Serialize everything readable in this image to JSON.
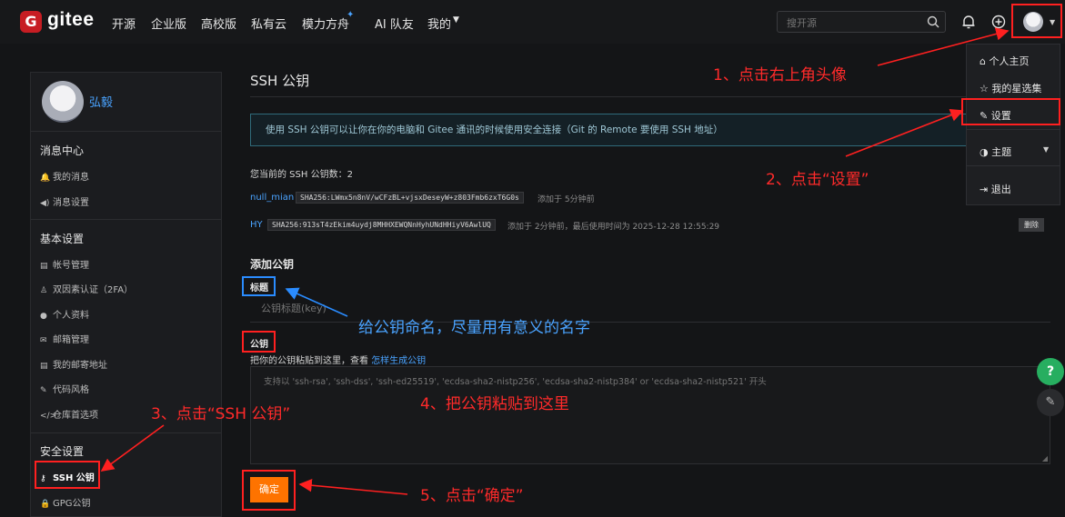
{
  "nav": {
    "brand": "gitee",
    "items": [
      "开源",
      "企业版",
      "高校版",
      "私有云",
      "模力方舟",
      "AI 队友",
      "我的"
    ],
    "search_placeholder": "搜开源"
  },
  "sidebar": {
    "username": "弘毅",
    "sections": [
      {
        "title": "消息中心",
        "items": [
          "我的消息",
          "消息设置"
        ]
      },
      {
        "title": "基本设置",
        "items": [
          "帐号管理",
          "双因素认证（2FA）",
          "个人资料",
          "邮箱管理",
          "我的邮寄地址",
          "代码风格",
          "仓库首选项"
        ]
      },
      {
        "title": "安全设置",
        "items": [
          "SSH 公钥",
          "GPG公钥"
        ]
      }
    ]
  },
  "main": {
    "title": "SSH 公钥",
    "info": "使用 SSH 公钥可以让你在你的电脑和 Gitee 通讯的时候使用安全连接（Git 的 Remote 要使用 SSH 地址）",
    "count_label": "您当前的 SSH 公钥数：",
    "count": "2",
    "keys": [
      {
        "name": "null_mian",
        "fingerprint": "SHA256:LWmx5n8nV/wCFzBL+vjsxDeseyW+z803Fmb6zxT6G0s",
        "meta": "添加于 5分钟前"
      },
      {
        "name": "HY",
        "fingerprint": "SHA256:913sT4zEkim4uydj8MHHXEWQNnHyhUNdHHiyV6AwlUQ",
        "meta": "添加于 2分钟前，最后使用时间为 2025-12-28 12:55:29",
        "delete": "删除"
      }
    ],
    "add_title": "添加公钥",
    "label_title": "标题",
    "title_placeholder": "公钥标题(key)",
    "label_key": "公钥",
    "paste_hint": "把你的公钥粘贴到这里，查看",
    "paste_link": "怎样生成公钥",
    "key_placeholder": "支持以 'ssh-rsa', 'ssh-dss', 'ssh-ed25519', 'ecdsa-sha2-nistp256', 'ecdsa-sha2-nistp384' or 'ecdsa-sha2-nistp521' 开头",
    "submit": "确定"
  },
  "dropdown": {
    "items": [
      "个人主页",
      "我的星选集",
      "设置",
      "主题",
      "退出"
    ]
  },
  "float": {
    "help": "?"
  },
  "annotations": {
    "a1": "1、点击右上角头像",
    "a2": "2、点击“设置”",
    "a3": "3、点击“SSH 公钥”",
    "a4": "4、把公钥粘贴到这里",
    "a5": "5、点击“确定”",
    "a6": "给公钥命名，尽量用有意义的名字"
  },
  "colors": {
    "accent": "#fe7300",
    "brand": "#c71d23",
    "annotation_red": "#ff2a2a",
    "annotation_blue": "#2a8cff",
    "info_border": "#2f6a7a"
  }
}
